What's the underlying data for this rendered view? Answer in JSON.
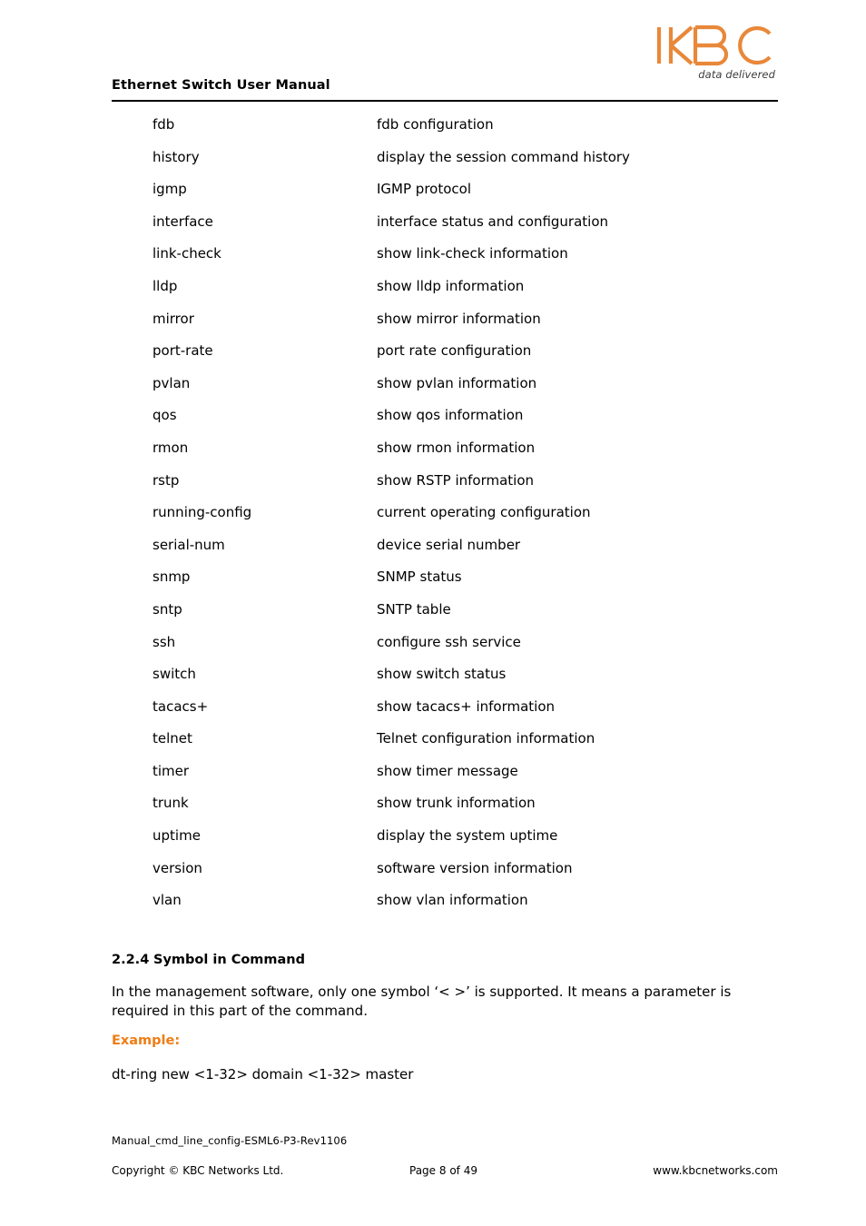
{
  "header": {
    "title": "Ethernet Switch User Manual",
    "logo_text": "KBC",
    "logo_tagline": "data delivered",
    "logo_color": "#e8883a"
  },
  "command_table": {
    "rows": [
      {
        "command": "fdb",
        "description": "fdb configuration"
      },
      {
        "command": "history",
        "description": "display the session command history"
      },
      {
        "command": "igmp",
        "description": "IGMP protocol"
      },
      {
        "command": "interface",
        "description": "interface status and configuration"
      },
      {
        "command": "link-check",
        "description": "show link-check information"
      },
      {
        "command": "lldp",
        "description": "show lldp information"
      },
      {
        "command": "mirror",
        "description": "show mirror information"
      },
      {
        "command": "port-rate",
        "description": "port rate configuration"
      },
      {
        "command": "pvlan",
        "description": "show pvlan information"
      },
      {
        "command": "qos",
        "description": "show qos information"
      },
      {
        "command": "rmon",
        "description": "show rmon information"
      },
      {
        "command": "rstp",
        "description": "show RSTP information"
      },
      {
        "command": "running-config",
        "description": "current operating configuration"
      },
      {
        "command": "serial-num",
        "description": "device serial number"
      },
      {
        "command": "snmp",
        "description": "SNMP status"
      },
      {
        "command": "sntp",
        "description": "SNTP table"
      },
      {
        "command": "ssh",
        "description": "configure ssh service"
      },
      {
        "command": "switch",
        "description": "show switch status"
      },
      {
        "command": "tacacs+",
        "description": "show tacacs+ information"
      },
      {
        "command": "telnet",
        "description": "Telnet configuration information"
      },
      {
        "command": "timer",
        "description": "show timer message"
      },
      {
        "command": "trunk",
        "description": "show trunk information"
      },
      {
        "command": "uptime",
        "description": "display the system uptime"
      },
      {
        "command": "version",
        "description": "software version information"
      },
      {
        "command": "vlan",
        "description": "show vlan information"
      }
    ]
  },
  "section": {
    "number": "2.2.4",
    "heading": "Symbol in Command",
    "paragraph": "In the management software, only one symbol ‘< >’ is supported. It means a parameter is required in this part of the command.",
    "example_label": "Example:",
    "example_command": "dt-ring new <1-32> domain <1-32> master",
    "example_color": "#ee7d14"
  },
  "footer": {
    "document_id": "Manual_cmd_line_config-ESML6-P3-Rev1106",
    "copyright": "Copyright © KBC Networks Ltd.",
    "page": "Page 8 of 49",
    "website": "www.kbcnetworks.com"
  }
}
